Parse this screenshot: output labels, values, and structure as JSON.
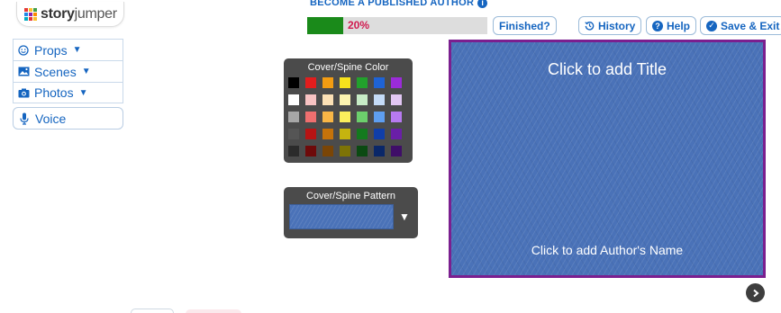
{
  "app": {
    "logo_text": "story",
    "logo_text_suffix": "jumper"
  },
  "sidebar": {
    "items": [
      {
        "label": "Props",
        "icon": "smiley-icon"
      },
      {
        "label": "Scenes",
        "icon": "image-icon"
      },
      {
        "label": "Photos",
        "icon": "camera-icon"
      }
    ],
    "voice_label": "Voice"
  },
  "progress": {
    "heading": "BECOME A PUBLISHED AUTHOR",
    "percent_text": "20%",
    "percent": 20,
    "fill_color": "#1a8a1a"
  },
  "toolbar": {
    "finished_label": "Finished?",
    "history_label": "History",
    "help_label": "Help",
    "save_exit_label": "Save & Exit"
  },
  "color_panel": {
    "title": "Cover/Spine Color",
    "colors": [
      "#000000",
      "#e21d1d",
      "#f39c12",
      "#f7e21c",
      "#22a12c",
      "#1e63d6",
      "#9b2bd9",
      "#ffffff",
      "#f7c2c2",
      "#fbe0b5",
      "#fdf4b0",
      "#c7ecc6",
      "#c4dbf7",
      "#e2c7f3",
      "#a6a6a6",
      "#ef6f6f",
      "#f8b646",
      "#fbef5c",
      "#6ccf6c",
      "#5e9ef0",
      "#b77af0",
      "#555555",
      "#b71414",
      "#c6730a",
      "#c5b40f",
      "#137a1e",
      "#103ea8",
      "#6a1fa8",
      "#2b2b2b",
      "#6e0a0a",
      "#7a4506",
      "#7d7306",
      "#0b4a12",
      "#0a2768",
      "#3f0e68"
    ]
  },
  "pattern_panel": {
    "title": "Cover/Spine Pattern"
  },
  "cover": {
    "title_placeholder": "Click to add Title",
    "author_placeholder": "Click to add Author's Name",
    "background_color": "#4a72b8",
    "border_color": "#7b1f8f"
  }
}
